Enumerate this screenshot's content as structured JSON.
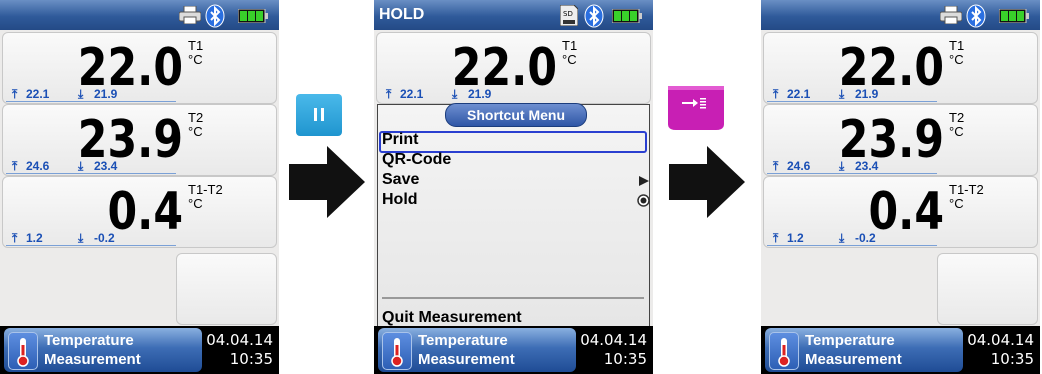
{
  "screens": [
    {
      "topbar": {
        "status": ""
      },
      "readings": [
        {
          "value": "22.0",
          "label": "T1\n°C",
          "max": "22.1",
          "min": "21.9"
        },
        {
          "value": "23.9",
          "label": "T2\n°C",
          "max": "24.6",
          "min": "23.4"
        },
        {
          "value": "0.4",
          "label": "T1-T2\n°C",
          "max": "1.2",
          "min": "-0.2"
        }
      ],
      "bottom": {
        "line1": "Temperature",
        "line2": "Measurement",
        "date": "04.04.14",
        "time": "10:35"
      }
    },
    {
      "topbar": {
        "status": "HOLD"
      },
      "readings": [
        {
          "value": "22.0",
          "label": "T1\n°C",
          "max": "22.1",
          "min": "21.9"
        }
      ],
      "menu": {
        "title": "Shortcut Menu",
        "items": [
          "Print",
          "QR-Code",
          "Save",
          "Hold"
        ],
        "quit": "Quit Measurement"
      },
      "bottom": {
        "line1": "Temperature",
        "line2": "Measurement",
        "date": "04.04.14",
        "time": "10:35"
      }
    },
    {
      "topbar": {
        "status": ""
      },
      "readings": [
        {
          "value": "22.0",
          "label": "T1\n°C",
          "max": "22.1",
          "min": "21.9"
        },
        {
          "value": "23.9",
          "label": "T2\n°C",
          "max": "24.6",
          "min": "23.4"
        },
        {
          "value": "0.4",
          "label": "T1-T2\n°C",
          "max": "1.2",
          "min": "-0.2"
        }
      ],
      "bottom": {
        "line1": "Temperature",
        "line2": "Measurement",
        "date": "04.04.14",
        "time": "10:35"
      }
    }
  ],
  "buttons": {
    "pause": "pause-icon",
    "print": "print-arrow-icon"
  },
  "colors": {
    "accent_blue": "#2f5a9a",
    "pause_button": "#2aa7de",
    "print_button": "#c81fb4"
  }
}
